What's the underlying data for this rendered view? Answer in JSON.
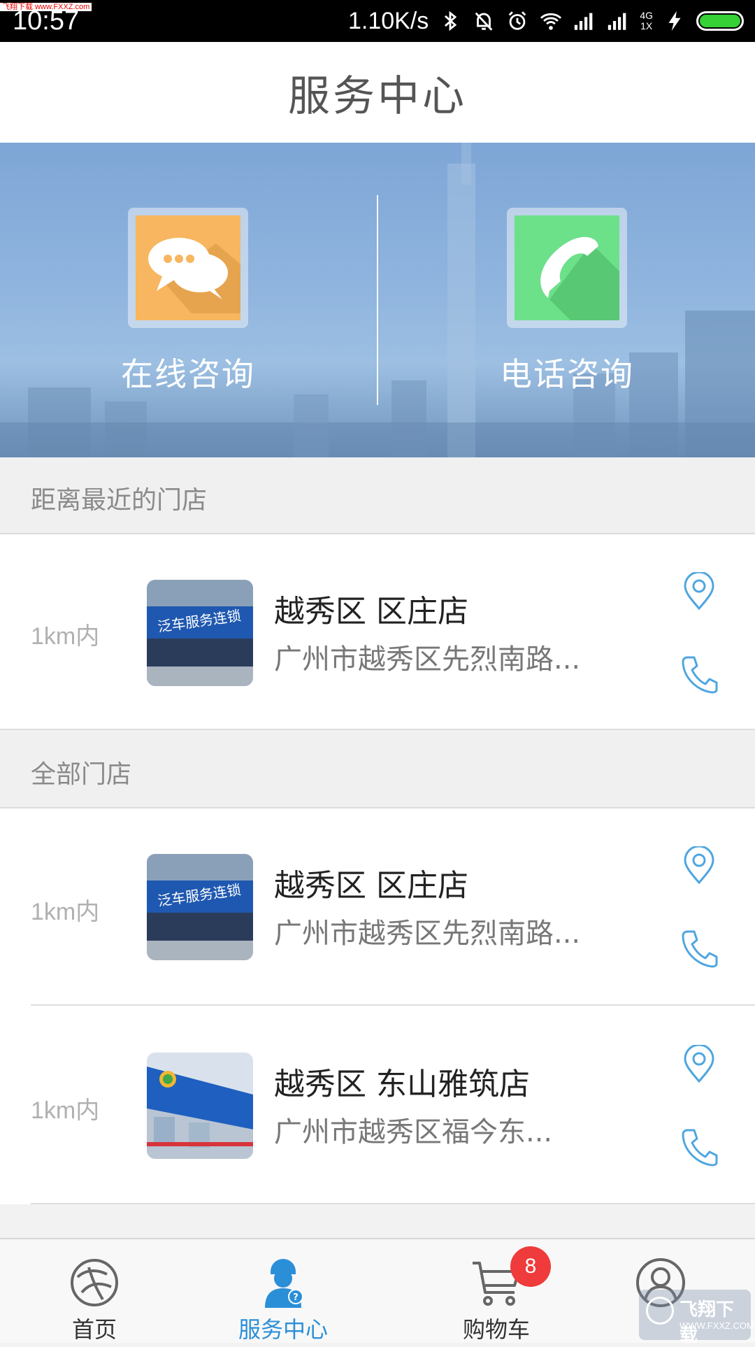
{
  "status_bar": {
    "watermark": "飞翔下载 www.FXXZ.com",
    "time": "10:57",
    "net_speed": "1.10K/s",
    "net_type_top": "4G",
    "net_type_bottom": "1X",
    "battery_level": 1.0
  },
  "header": {
    "title": "服务中心"
  },
  "services": {
    "online": {
      "label": "在线咨询",
      "icon": "chat-bubbles-icon",
      "color": "#f7b65f"
    },
    "phone": {
      "label": "电话咨询",
      "icon": "phone-icon",
      "color": "#6de08a"
    }
  },
  "sections": {
    "nearest": "距离最近的门店",
    "all": "全部门店"
  },
  "nearest_store": {
    "distance": "1km内",
    "name": "越秀区 区庄店",
    "address": "广州市越秀区先烈南路..."
  },
  "stores": [
    {
      "distance": "1km内",
      "name": "越秀区 区庄店",
      "address": "广州市越秀区先烈南路..."
    },
    {
      "distance": "1km内",
      "name": "越秀区 东山雅筑店",
      "address": "广州市越秀区福今东..."
    }
  ],
  "bottom_nav": {
    "home": "首页",
    "service": "服务中心",
    "cart": "购物车",
    "cart_badge": "8",
    "profile_icon": "profile-icon"
  },
  "watermark": {
    "title": "飞翔下载",
    "url": "WWW.FXXZ.COM"
  },
  "colors": {
    "accent": "#2b8fd8",
    "badge": "#ef3b3b",
    "action_icon": "#4ea6e0"
  }
}
